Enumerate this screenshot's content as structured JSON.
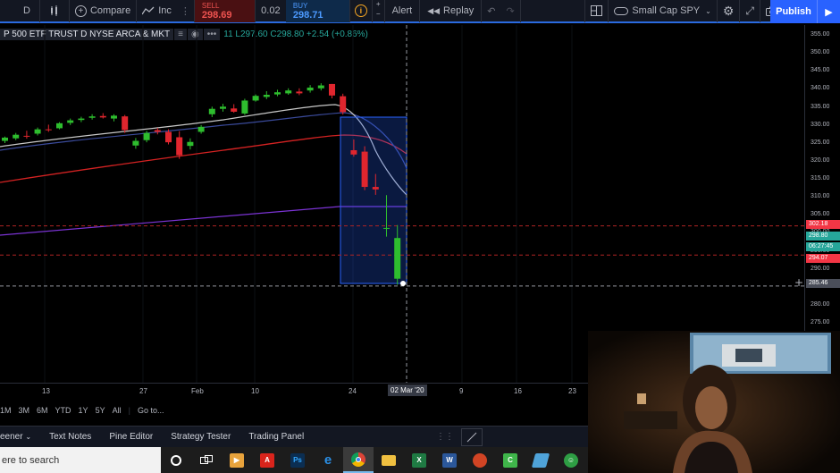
{
  "toolbar": {
    "interval": "D",
    "compare_label": "Compare",
    "indicators_label": "Inc",
    "sell_label": "SELL",
    "sell_price": "298.69",
    "spread": "0.02",
    "buy_label": "BUY",
    "buy_price": "298.71",
    "alert_label": "Alert",
    "replay_label": "Replay",
    "layout_name": "Small Cap SPY",
    "publish_label": "Publish"
  },
  "legend": {
    "symbol": "P 500 ETF TRUST  D  NYSE ARCA & MKT",
    "ohlc": "11  L297.60  C298.80  +2.54 (+0.86%)"
  },
  "chart_data": {
    "type": "candlestick",
    "y_ticks": [
      "355.00",
      "350.00",
      "345.00",
      "340.00",
      "335.00",
      "330.00",
      "325.00",
      "320.00",
      "315.00",
      "310.00",
      "305.00",
      "300.00",
      "295.00",
      "290.00",
      "285.00",
      "280.00",
      "275.00"
    ],
    "ylim": [
      272,
      357
    ],
    "x_ticks": [
      "13",
      "27",
      "Feb",
      "10",
      "24",
      "9",
      "16",
      "23"
    ],
    "crosshair_x_label": "02 Mar '20",
    "price_labels": [
      {
        "text": "302.18",
        "value": 302.18,
        "color": "#f23645"
      },
      {
        "text": "298.80",
        "value": 298.8,
        "color": "#26a69a"
      },
      {
        "text": "06:27:45",
        "value": 296.5,
        "color": "#26a69a"
      },
      {
        "text": "294.07",
        "value": 294.07,
        "color": "#f23645"
      },
      {
        "text": "285.46",
        "value": 285.46,
        "color": "#4a4e59"
      }
    ],
    "candles": [
      {
        "o": 325.8,
        "h": 327.0,
        "l": 325.2,
        "c": 326.7
      },
      {
        "o": 326.5,
        "h": 328.0,
        "l": 326.0,
        "c": 327.5
      },
      {
        "o": 327.2,
        "h": 328.6,
        "l": 326.4,
        "c": 327.0
      },
      {
        "o": 327.8,
        "h": 329.5,
        "l": 327.3,
        "c": 329.0
      },
      {
        "o": 329.0,
        "h": 330.3,
        "l": 328.3,
        "c": 328.8
      },
      {
        "o": 329.3,
        "h": 331.0,
        "l": 329.0,
        "c": 330.7
      },
      {
        "o": 330.8,
        "h": 332.0,
        "l": 330.2,
        "c": 331.5
      },
      {
        "o": 331.6,
        "h": 332.5,
        "l": 331.0,
        "c": 332.0
      },
      {
        "o": 332.2,
        "h": 333.2,
        "l": 331.7,
        "c": 332.6
      },
      {
        "o": 332.7,
        "h": 333.5,
        "l": 332.0,
        "c": 332.3
      },
      {
        "o": 332.0,
        "h": 333.2,
        "l": 331.2,
        "c": 332.8
      },
      {
        "o": 332.6,
        "h": 333.0,
        "l": 328.0,
        "c": 328.8
      },
      {
        "o": 324.5,
        "h": 326.6,
        "l": 323.6,
        "c": 325.8
      },
      {
        "o": 326.0,
        "h": 328.6,
        "l": 325.4,
        "c": 328.0
      },
      {
        "o": 328.8,
        "h": 329.4,
        "l": 327.6,
        "c": 328.3
      },
      {
        "o": 328.3,
        "h": 329.0,
        "l": 324.8,
        "c": 325.4
      },
      {
        "o": 326.8,
        "h": 328.5,
        "l": 320.8,
        "c": 321.8
      },
      {
        "o": 324.4,
        "h": 326.5,
        "l": 323.4,
        "c": 325.5
      },
      {
        "o": 328.3,
        "h": 330.2,
        "l": 327.8,
        "c": 329.7
      },
      {
        "o": 333.2,
        "h": 335.3,
        "l": 332.4,
        "c": 334.7
      },
      {
        "o": 334.7,
        "h": 336.1,
        "l": 333.9,
        "c": 335.3
      },
      {
        "o": 334.8,
        "h": 336.0,
        "l": 333.6,
        "c": 333.9
      },
      {
        "o": 333.4,
        "h": 337.5,
        "l": 333.0,
        "c": 337.0
      },
      {
        "o": 337.0,
        "h": 338.7,
        "l": 336.7,
        "c": 338.3
      },
      {
        "o": 338.0,
        "h": 339.6,
        "l": 337.4,
        "c": 338.6
      },
      {
        "o": 338.7,
        "h": 340.0,
        "l": 338.2,
        "c": 339.3
      },
      {
        "o": 339.0,
        "h": 340.4,
        "l": 338.6,
        "c": 339.8
      },
      {
        "o": 339.5,
        "h": 340.4,
        "l": 338.5,
        "c": 339.0
      },
      {
        "o": 339.8,
        "h": 341.3,
        "l": 339.2,
        "c": 340.6
      },
      {
        "o": 340.4,
        "h": 341.8,
        "l": 339.8,
        "c": 341.2
      },
      {
        "o": 341.6,
        "h": 341.6,
        "l": 337.6,
        "c": 338.4
      },
      {
        "o": 338.2,
        "h": 338.9,
        "l": 333.1,
        "c": 333.8
      },
      {
        "o": 323.2,
        "h": 326.2,
        "l": 321.4,
        "c": 322.0
      },
      {
        "o": 322.8,
        "h": 324.3,
        "l": 312.1,
        "c": 313.0
      },
      {
        "o": 313.0,
        "h": 316.6,
        "l": 310.8,
        "c": 312.3
      },
      {
        "o": 301.6,
        "h": 310.7,
        "l": 299.2,
        "c": 301.6
      },
      {
        "o": 287.5,
        "h": 302.4,
        "l": 285.8,
        "c": 298.8
      }
    ]
  },
  "bottom_bar": {
    "ranges": [
      "1M",
      "3M",
      "6M",
      "YTD",
      "1Y",
      "5Y",
      "All"
    ],
    "goto_label": "Go to...",
    "panels": [
      "eener",
      "Text Notes",
      "Pine Editor",
      "Strategy Tester",
      "Trading Panel"
    ]
  },
  "taskbar": {
    "search_placeholder": "ere to search",
    "apps": [
      {
        "name": "cortana-icon",
        "color": "#1c1c1c"
      },
      {
        "name": "task-view-icon",
        "color": "#1c1c1c"
      },
      {
        "name": "media-icon",
        "color": "#e8a33c"
      },
      {
        "name": "acrobat-icon",
        "color": "#d9241c"
      },
      {
        "name": "photoshop-icon",
        "color": "#0b2e52"
      },
      {
        "name": "edge-icon",
        "color": "#1e6fd9"
      },
      {
        "name": "chrome-icon",
        "color": "#e8a33c"
      },
      {
        "name": "file-explorer-icon",
        "color": "#f0c040"
      },
      {
        "name": "excel-icon",
        "color": "#1f7a43"
      },
      {
        "name": "word-icon",
        "color": "#2b579a"
      },
      {
        "name": "powerpoint-icon",
        "color": "#d14424"
      },
      {
        "name": "camtasia-icon",
        "color": "#3fb54a"
      },
      {
        "name": "notes-icon",
        "color": "#4fa3d9"
      },
      {
        "name": "greenshot-icon",
        "color": "#2e9e44"
      }
    ],
    "app_labels": {
      "photoshop": "Ps",
      "excel": "X",
      "word": "W"
    }
  }
}
